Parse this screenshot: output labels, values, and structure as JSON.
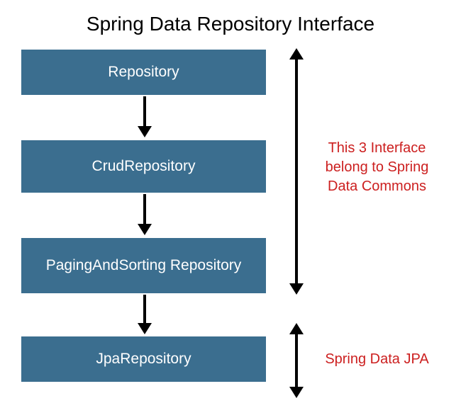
{
  "title": "Spring Data Repository Interface",
  "boxes": {
    "repository": "Repository",
    "crud": "CrudRepository",
    "paging": "PagingAndSorting Repository",
    "jpa": "JpaRepository"
  },
  "annotations": {
    "commons": "This 3 Interface belong to Spring Data Commons",
    "jpa": "Spring Data JPA"
  }
}
